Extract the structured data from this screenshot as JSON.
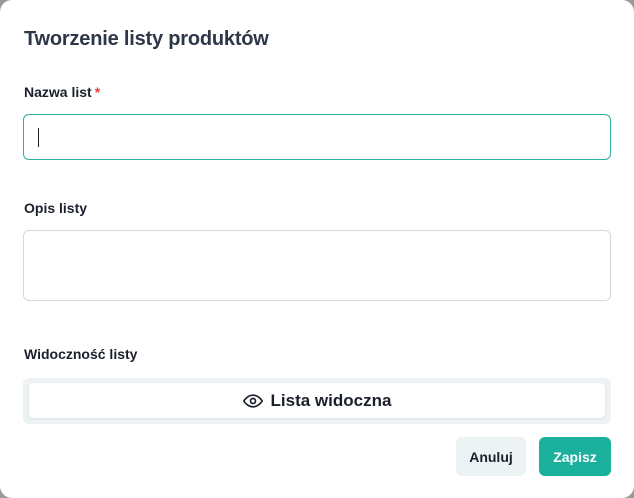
{
  "dialog": {
    "title": "Tworzenie listy produktów"
  },
  "form": {
    "name_label": "Nazwa list",
    "name_required_mark": "*",
    "name_value": "",
    "description_label": "Opis listy",
    "description_value": "",
    "visibility_label": "Widoczność listy",
    "visibility_option_label": "Lista widoczna",
    "visibility_icon": "eye-icon"
  },
  "actions": {
    "cancel_label": "Anuluj",
    "save_label": "Zapisz"
  },
  "colors": {
    "accent": "#1ab09c",
    "focus_border": "#2fae9c",
    "required": "#e53e3e",
    "title_text": "#2d3748"
  }
}
